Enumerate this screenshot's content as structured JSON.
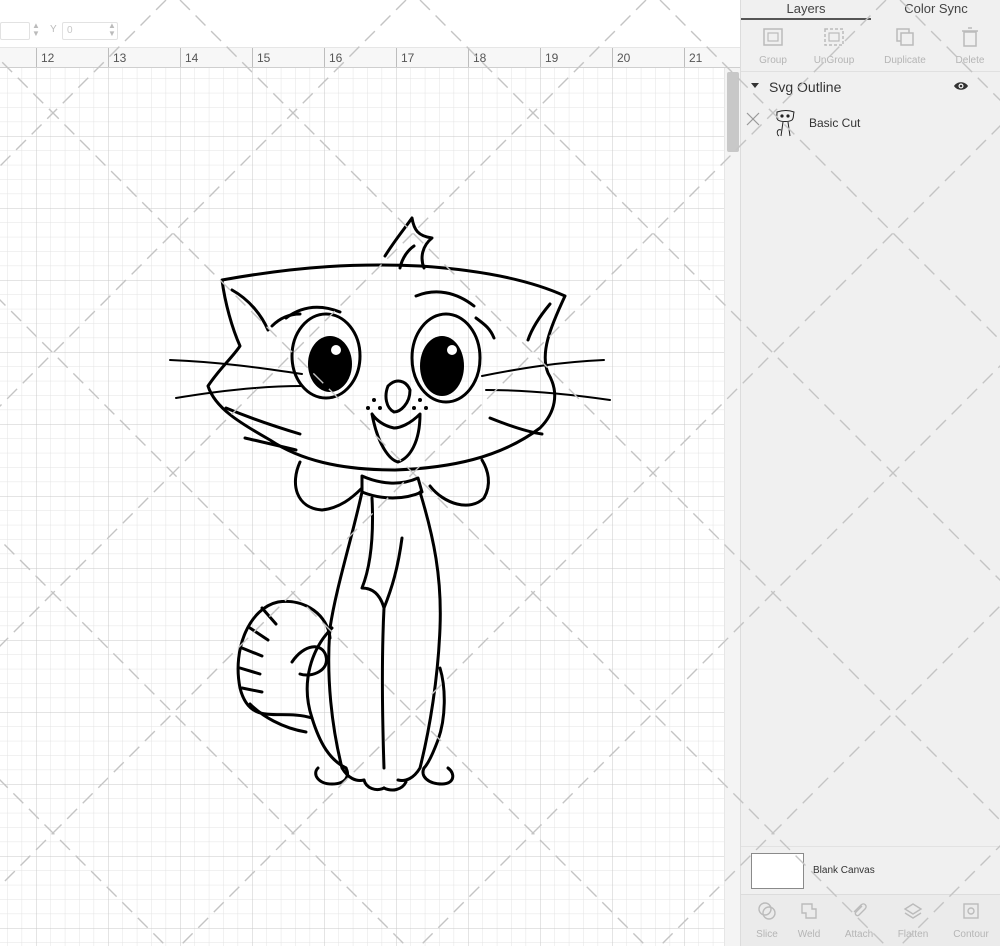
{
  "topbar": {
    "x_value": "",
    "y_label": "Y",
    "y_value": "0"
  },
  "ruler": {
    "ticks": [
      "12",
      "13",
      "14",
      "15",
      "16",
      "17",
      "18",
      "19",
      "20",
      "21"
    ]
  },
  "panel": {
    "tabs": [
      {
        "label": "Layers",
        "active": true
      },
      {
        "label": "Color Sync",
        "active": false
      }
    ],
    "top_tools": [
      {
        "label": "Group",
        "icon": "group-icon"
      },
      {
        "label": "UnGroup",
        "icon": "ungroup-icon"
      },
      {
        "label": "Duplicate",
        "icon": "duplicate-icon"
      },
      {
        "label": "Delete",
        "icon": "delete-icon"
      }
    ],
    "layer_group": {
      "name": "Svg Outline",
      "visible": true
    },
    "layer": {
      "name": "Basic Cut",
      "icon": "cat-thumbnail"
    },
    "blank_canvas": {
      "label": "Blank Canvas",
      "color": "#ffffff"
    },
    "bottom_tools": [
      {
        "label": "Slice",
        "icon": "slice-icon"
      },
      {
        "label": "Weld",
        "icon": "weld-icon"
      },
      {
        "label": "Attach",
        "icon": "attach-icon"
      },
      {
        "label": "Flatten",
        "icon": "flatten-icon"
      },
      {
        "label": "Contour",
        "icon": "contour-icon"
      }
    ]
  },
  "colors": {
    "grid_minor": "#e3e3e3",
    "grid_major": "#c9c9c9",
    "watermark": "#bdbdbd",
    "outline": "#000000"
  }
}
